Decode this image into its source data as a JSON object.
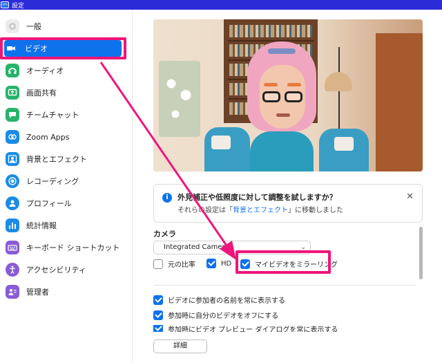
{
  "window": {
    "title": "設定",
    "app_icon_text": "zm"
  },
  "sidebar": {
    "items": [
      {
        "label": "一般",
        "icon": "gear-icon",
        "icon_color": "#e6e6e6",
        "active": false
      },
      {
        "label": "ビデオ",
        "icon": "video-icon",
        "icon_color": "#0e72ed",
        "active": true
      },
      {
        "label": "オーディオ",
        "icon": "headphones-icon",
        "icon_color": "#27b36a",
        "active": false
      },
      {
        "label": "画面共有",
        "icon": "share-screen-icon",
        "icon_color": "#27b36a",
        "active": false
      },
      {
        "label": "チームチャット",
        "icon": "chat-icon",
        "icon_color": "#27b36a",
        "active": false
      },
      {
        "label": "Zoom Apps",
        "icon": "apps-icon",
        "icon_color": "#1a8be8",
        "active": false
      },
      {
        "label": "背景とエフェクト",
        "icon": "background-icon",
        "icon_color": "#1a8be8",
        "active": false
      },
      {
        "label": "レコーディング",
        "icon": "record-icon",
        "icon_color": "#1a8be8",
        "active": false
      },
      {
        "label": "プロフィール",
        "icon": "profile-icon",
        "icon_color": "#1a8be8",
        "active": false
      },
      {
        "label": "統計情報",
        "icon": "stats-icon",
        "icon_color": "#1a8be8",
        "active": false
      },
      {
        "label": "キーボード ショートカット",
        "icon": "keyboard-icon",
        "icon_color": "#8a5bd6",
        "active": false
      },
      {
        "label": "アクセシビリティ",
        "icon": "accessibility-icon",
        "icon_color": "#8a5bd6",
        "active": false
      },
      {
        "label": "管理者",
        "icon": "admin-icon",
        "icon_color": "#8a5bd6",
        "active": false
      }
    ]
  },
  "notice": {
    "title": "外見補正や低照度に対して調整を試しますか？",
    "body_prefix": "それらの設定は「",
    "body_link": "背景とエフェクト",
    "body_suffix": "」に移動しました"
  },
  "camera": {
    "label": "カメラ",
    "selected": "Integrated Camera",
    "options": {
      "original_ratio": {
        "label": "元の比率",
        "checked": false
      },
      "hd": {
        "label": "HD",
        "checked": true
      },
      "mirror": {
        "label": "マイビデオをミラーリング",
        "checked": true
      }
    }
  },
  "settings": [
    {
      "label": "ビデオに参加者の名前を常に表示する",
      "checked": true
    },
    {
      "label": "参加時に自分のビデオをオフにする",
      "checked": true
    },
    {
      "label": "参加時にビデオ プレビュー ダイアログを常に表示する",
      "checked": true
    }
  ],
  "detail_button": "詳細",
  "colors": {
    "accent": "#0e72ed",
    "highlight": "#f0157a",
    "titlebar": "#2b2bd8"
  }
}
